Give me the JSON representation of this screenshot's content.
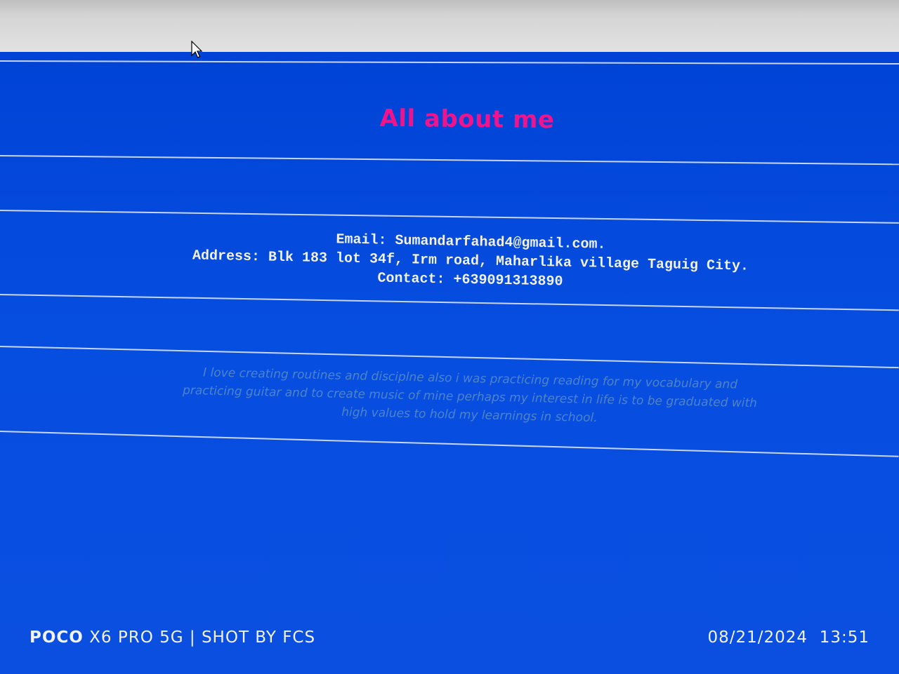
{
  "page": {
    "title": "All about me",
    "contact": {
      "email_line": "Email: Sumandarfahad4@gmail.com.",
      "address_line": "Address: Blk 183 lot 34f, Irm road, Maharlika village Taguig City.",
      "contact_line": "Contact: +639091313890"
    },
    "about_text": "I love creating routines and disciplne also i was practicing reading for my vocabulary and practicing guitar and to create music of mine perhaps my interest in life is to be graduated with high values to hold my learnings in school."
  },
  "camera_watermark": {
    "brand": "POCO",
    "model_text": "X6 PRO 5G | SHOT BY FCS",
    "date": "08/21/2024",
    "time": "13:51"
  },
  "colors": {
    "background": "#0a47d9",
    "title": "#f0148c",
    "contact_text": "#f3f1e6",
    "about_text": "#4f83c8",
    "rule": "#c9d3f2"
  },
  "icons": {
    "cursor": "mouse-pointer-icon"
  }
}
